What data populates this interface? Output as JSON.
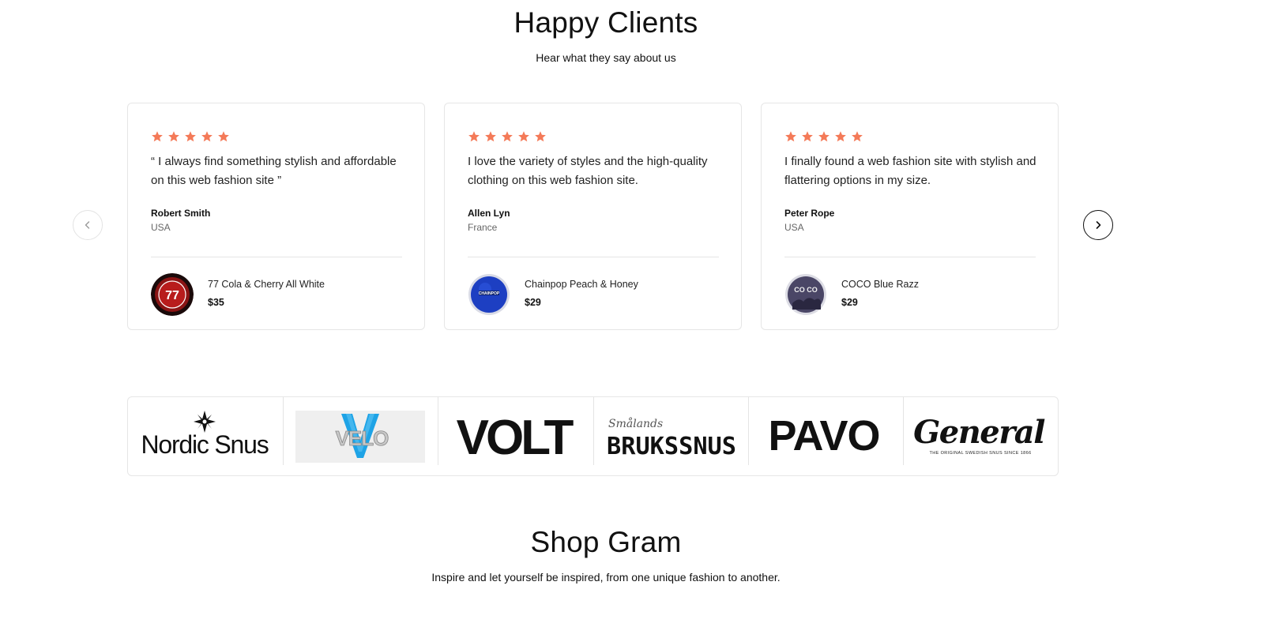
{
  "testimonials_section": {
    "title": "Happy Clients",
    "subtitle": "Hear what they say about us"
  },
  "testimonials": [
    {
      "rating": 5,
      "quote": "“ I always find something stylish and affordable on this web fashion site ”",
      "author": "Robert Smith",
      "country": "USA",
      "product_name": "77 Cola & Cherry All White",
      "product_price": "$35",
      "thumb_text": "77"
    },
    {
      "rating": 5,
      "quote": "I love the variety of styles and the high-quality clothing on this web fashion site.",
      "author": "Allen Lyn",
      "country": "France",
      "product_name": "Chainpop Peach & Honey",
      "product_price": "$29",
      "thumb_text": "CHAINPOP"
    },
    {
      "rating": 5,
      "quote": "I finally found a web fashion site with stylish and flattering options in my size.",
      "author": "Peter Rope",
      "country": "USA",
      "product_name": "COCO Blue Razz",
      "product_price": "$29",
      "thumb_text": "CO CO"
    }
  ],
  "brands": {
    "nordic": "Nordic Snus",
    "velo": "VELO",
    "volt": "VOLT",
    "bruks_script": "Smålands",
    "bruks_main": "BRUKSSNUS",
    "pavo": "PAVO",
    "general": "General",
    "general_tagline": "THE ORIGINAL SWEDISH SNUS SINCE 1866"
  },
  "shop_section": {
    "title": "Shop Gram",
    "subtitle": "Inspire and let yourself be inspired, from one unique fashion to another."
  },
  "colors": {
    "star": "#f47a58",
    "text": "#111111",
    "border": "#e6e6e6",
    "velo_blue": "#1ea3e6"
  },
  "icons": {
    "prev": "chevron-left-icon",
    "next": "chevron-right-icon",
    "rating": "star-icon"
  }
}
